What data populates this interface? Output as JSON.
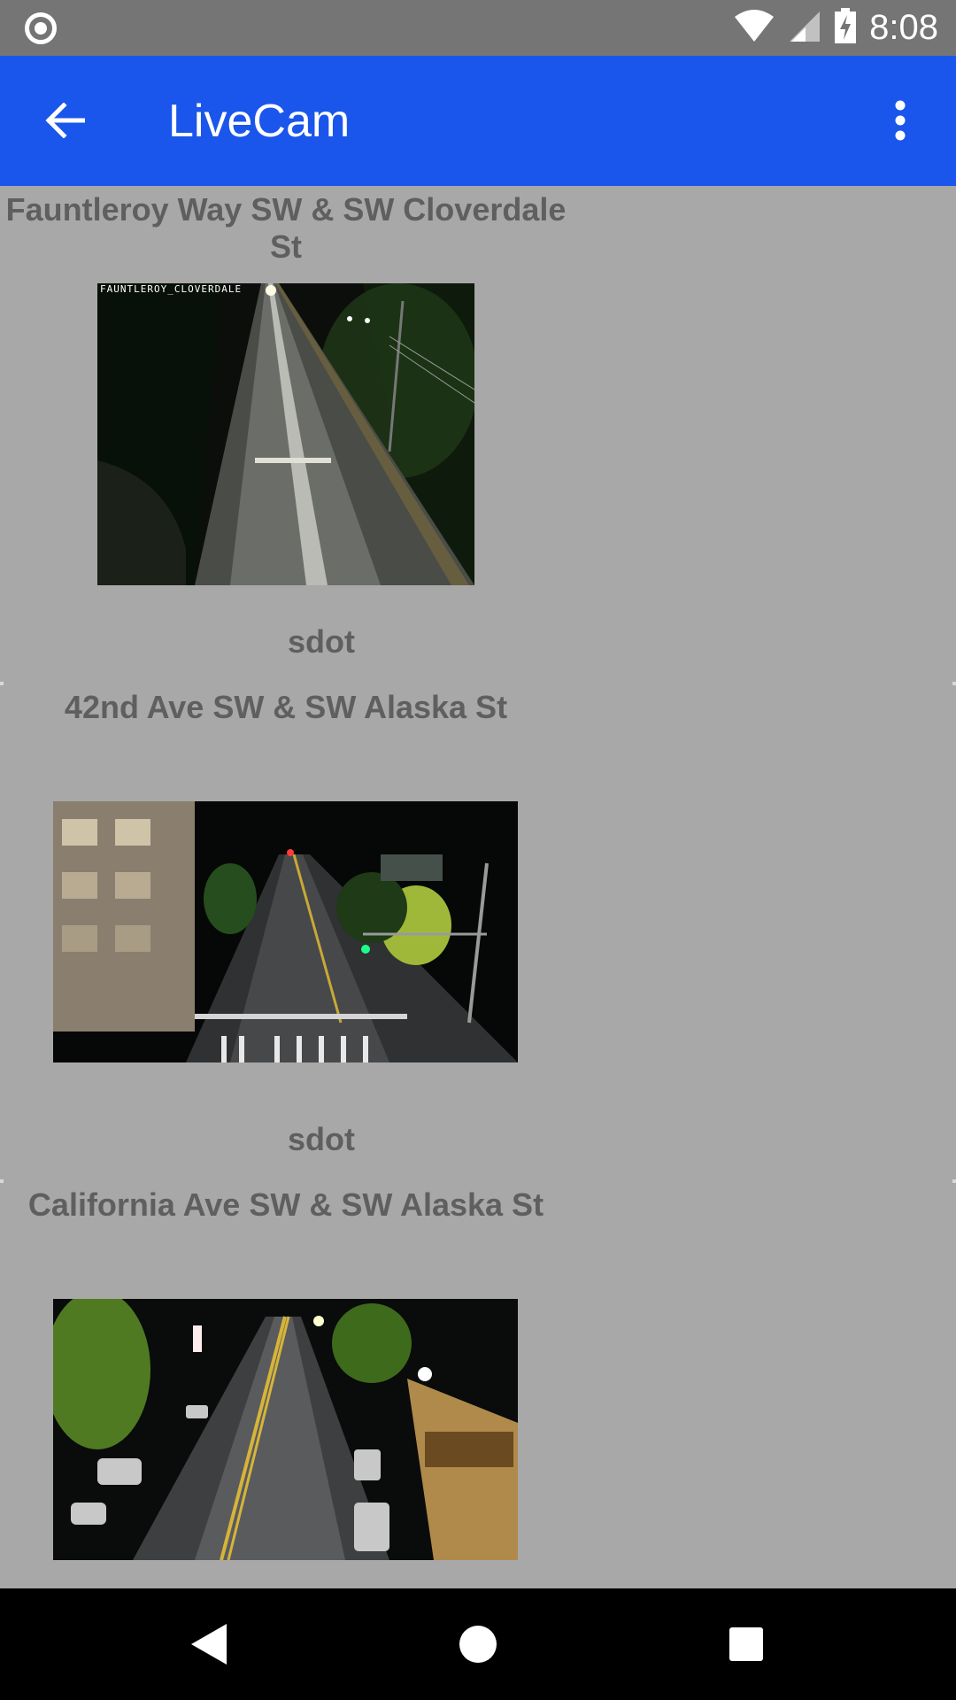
{
  "status_bar": {
    "time": "8:08",
    "icons": [
      "cast-icon",
      "wifi-icon",
      "signal-icon",
      "battery-charging-icon"
    ]
  },
  "app_bar": {
    "title": "LiveCam",
    "back_icon": "arrow-back-icon",
    "menu_icon": "more-vert-icon"
  },
  "cameras": [
    {
      "title": "Fauntleroy Way SW & SW Cloverdale St",
      "overlay_label": "FAUNTLEROY_CLOVERDALE",
      "source": "sdot"
    },
    {
      "title": "42nd Ave SW & SW Alaska St",
      "source": "sdot"
    },
    {
      "title": "California Ave SW & SW Alaska St"
    }
  ],
  "nav_bar": {
    "icons": [
      "back-triangle-icon",
      "home-circle-icon",
      "recents-square-icon"
    ]
  },
  "colors": {
    "status_bar": "#757575",
    "app_bar": "#1a56eb",
    "background": "#a8a8a8",
    "text": "#5f5f5f",
    "nav_bar": "#000000"
  }
}
